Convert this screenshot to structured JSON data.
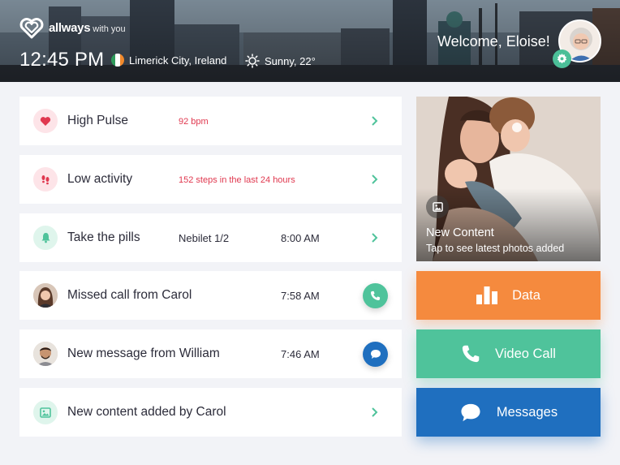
{
  "header": {
    "brand": "allways",
    "brand_suffix": "with you",
    "time": "12:45 PM",
    "location": "Limerick City, Ireland",
    "weather": "Sunny, 22°",
    "welcome": "Welcome, Eloise!"
  },
  "notifications": [
    {
      "title": "High Pulse",
      "note": "92 bpm",
      "icon": "heart-icon"
    },
    {
      "title": "Low activity",
      "note": "152 steps in the last 24 hours",
      "icon": "footsteps-icon"
    },
    {
      "title": "Take the pills",
      "note": "Nebilet 1/2",
      "time": "8:00 AM",
      "icon": "bell-icon"
    },
    {
      "title": "Missed call from Carol",
      "time": "7:58 AM",
      "icon": "carol-avatar"
    },
    {
      "title": "New message from William",
      "time": "7:46 AM",
      "icon": "william-avatar"
    },
    {
      "title": "New content added by Carol",
      "icon": "image-icon"
    }
  ],
  "photo": {
    "title": "New Content",
    "subtitle": "Tap to see latest photos added"
  },
  "actions": {
    "data": "Data",
    "video_call": "Video Call",
    "messages": "Messages"
  },
  "colors": {
    "red": "#e0384f",
    "green": "#4fc39b",
    "orange": "#f58a3e",
    "blue": "#1f6fbf"
  }
}
